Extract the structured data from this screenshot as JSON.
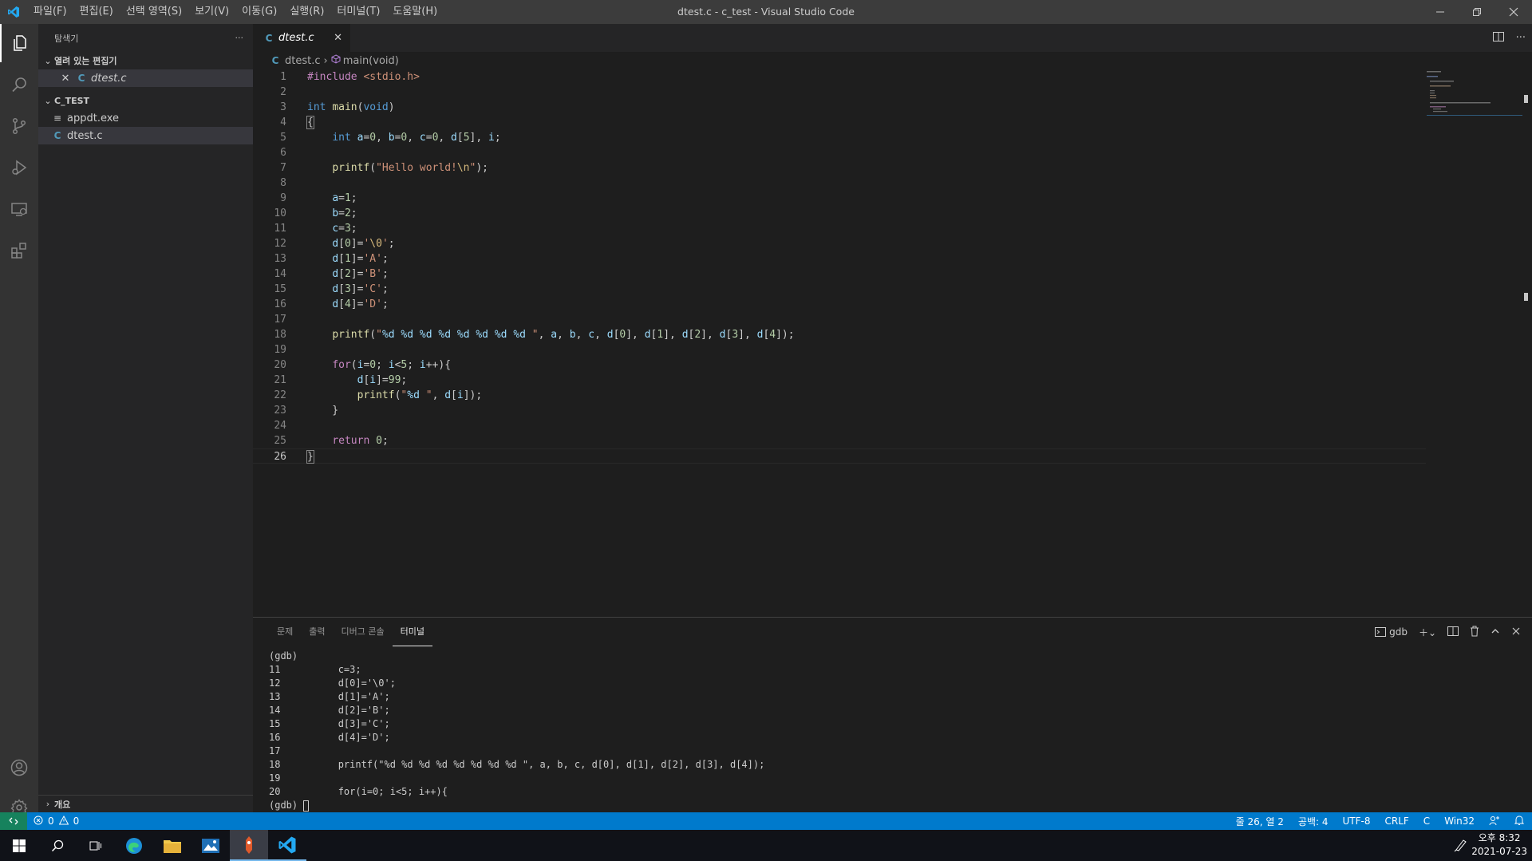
{
  "titlebar": {
    "menu": [
      "파일(F)",
      "편집(E)",
      "선택 영역(S)",
      "보기(V)",
      "이동(G)",
      "실행(R)",
      "터미널(T)",
      "도움말(H)"
    ],
    "title": "dtest.c - c_test - Visual Studio Code"
  },
  "sidebar": {
    "title": "탐색기",
    "more": "···",
    "open_editors": {
      "header": "열려 있는 편집기",
      "files": [
        {
          "name": "dtest.c",
          "icon": "C"
        }
      ]
    },
    "folder": {
      "header": "C_TEST",
      "files": [
        {
          "name": "appdt.exe",
          "icon": "≡"
        },
        {
          "name": "dtest.c",
          "icon": "C"
        }
      ]
    },
    "outline": "개요"
  },
  "editor": {
    "tab": {
      "label": "dtest.c",
      "icon": "C"
    },
    "breadcrumb": [
      "dtest.c",
      "main(void)"
    ],
    "current_line": 26
  },
  "panel": {
    "tabs": [
      "문제",
      "출력",
      "디버그 콘솔",
      "터미널"
    ],
    "active_tab": "터미널",
    "terminal_name": "gdb",
    "terminal_lines": [
      "(gdb)",
      "11          c=3;",
      "12          d[0]='\\0';",
      "13          d[1]='A';",
      "14          d[2]='B';",
      "15          d[3]='C';",
      "16          d[4]='D';",
      "17",
      "18          printf(\"%d %d %d %d %d %d %d %d \", a, b, c, d[0], d[1], d[2], d[3], d[4]);",
      "19",
      "20          for(i=0; i<5; i++){"
    ],
    "prompt": "(gdb) "
  },
  "statusbar": {
    "errors": "0",
    "warnings": "0",
    "position": "줄 26, 열 2",
    "spaces": "공백: 4",
    "encoding": "UTF-8",
    "eol": "CRLF",
    "language": "C",
    "platform": "Win32"
  },
  "taskbar": {
    "time": "오후 8:32",
    "date": "2021-07-23"
  },
  "colors": {
    "accent": "#007acc",
    "remote": "#16825d",
    "c_icon": "#519aba"
  }
}
